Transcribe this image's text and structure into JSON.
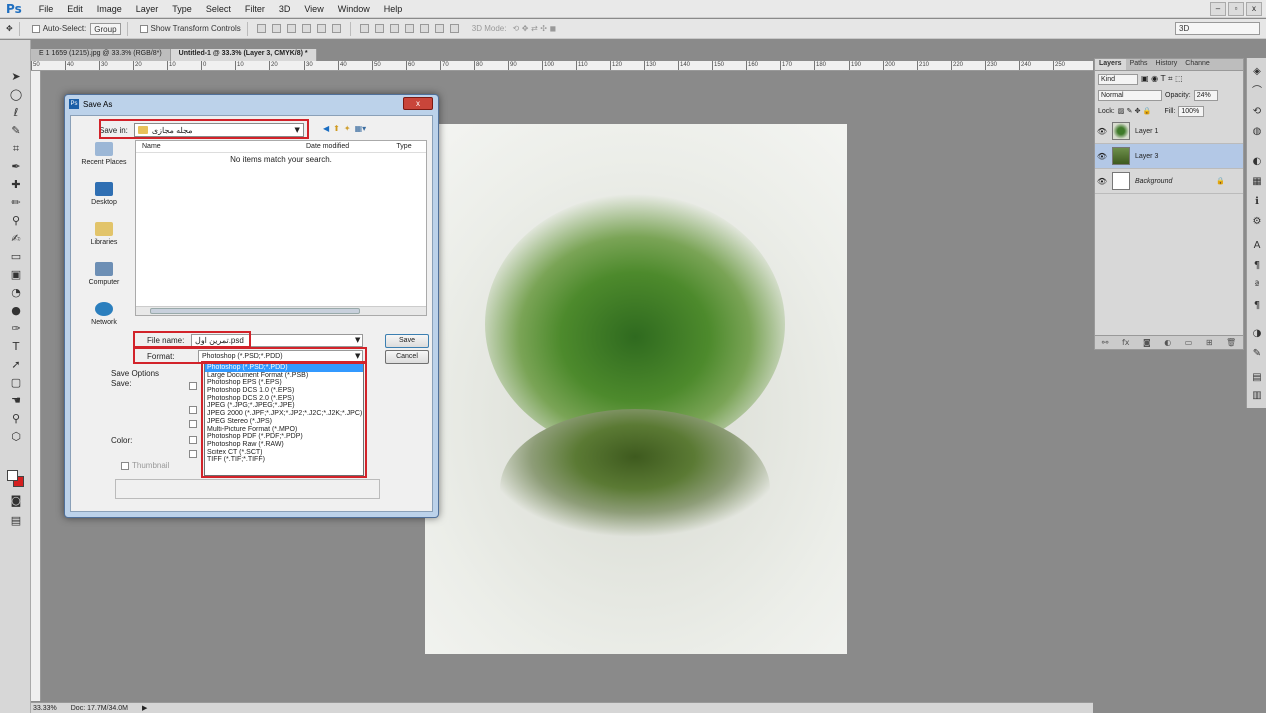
{
  "menubar": {
    "logo": "Ps",
    "items": [
      "File",
      "Edit",
      "Image",
      "Layer",
      "Type",
      "Select",
      "Filter",
      "3D",
      "View",
      "Window",
      "Help"
    ],
    "window_controls": [
      "–",
      "▫",
      "x"
    ]
  },
  "options_bar": {
    "auto_select_label": "Auto-Select:",
    "group_value": "Group",
    "show_transform_label": "Show Transform Controls",
    "mode_3d_label": "3D Mode:",
    "workspace_value": "3D"
  },
  "doc_tabs": [
    {
      "label": "E 1 1659 (1215).jpg @ 33.3% (RGB/8*)"
    },
    {
      "label": "Untitled-1 @ 33.3% (Layer 3, CMYK/8) *"
    }
  ],
  "ruler": {
    "ticks": [
      "50",
      "40",
      "30",
      "20",
      "10",
      "0",
      "10",
      "20",
      "30",
      "40",
      "50",
      "60",
      "70",
      "80",
      "90",
      "100",
      "110",
      "120",
      "130",
      "140",
      "150",
      "160",
      "170",
      "180",
      "190",
      "200",
      "210",
      "220",
      "230",
      "240",
      "250"
    ]
  },
  "status": {
    "zoom": "33.33%",
    "doc_size": "Doc: 17.7M/34.0M"
  },
  "layers_panel": {
    "tabs": [
      "Layers",
      "Paths",
      "History",
      "Channe"
    ],
    "kind_label": "Kind",
    "blend_mode": "Normal",
    "opacity_label": "Opacity:",
    "opacity_value": "24%",
    "lock_label": "Lock:",
    "fill_label": "Fill:",
    "fill_value": "100%",
    "layers": [
      {
        "name": "Layer 1"
      },
      {
        "name": "Layer 3"
      },
      {
        "name": "Background"
      }
    ]
  },
  "dialog": {
    "title": "Save As",
    "close_label": "x",
    "save_in_label": "Save in:",
    "save_in_value": "مجله مجازی",
    "places": [
      "Recent Places",
      "Desktop",
      "Libraries",
      "Computer",
      "Network"
    ],
    "columns": [
      "Name",
      "Date modified",
      "Type"
    ],
    "empty_message": "No items match your search.",
    "file_name_label": "File name:",
    "file_name_value": "تمرین اول.psd",
    "format_label": "Format:",
    "format_value": "Photoshop (*.PSD;*.PDD)",
    "save_button": "Save",
    "cancel_button": "Cancel",
    "format_options": [
      "Photoshop (*.PSD;*.PDD)",
      "Large Document Format (*.PSB)",
      "Photoshop EPS (*.EPS)",
      "Photoshop DCS 1.0 (*.EPS)",
      "Photoshop DCS 2.0 (*.EPS)",
      "JPEG (*.JPG;*.JPEG;*.JPE)",
      "JPEG 2000 (*.JPF;*.JPX;*.JP2;*.J2C;*.J2K;*.JPC)",
      "JPEG Stereo (*.JPS)",
      "Multi-Picture Format (*.MPO)",
      "Photoshop PDF (*.PDF;*.PDP)",
      "Photoshop Raw (*.RAW)",
      "Scitex CT (*.SCT)",
      "TIFF (*.TIF;*.TIFF)"
    ],
    "save_options_label": "Save Options",
    "save_label": "Save:",
    "color_label": "Color:",
    "thumbnail_label": "Thumbnail"
  },
  "colors": {
    "highlight": "#d2232a",
    "selection": "#3399ff",
    "photoshop_blue": "#1f6fc0"
  }
}
